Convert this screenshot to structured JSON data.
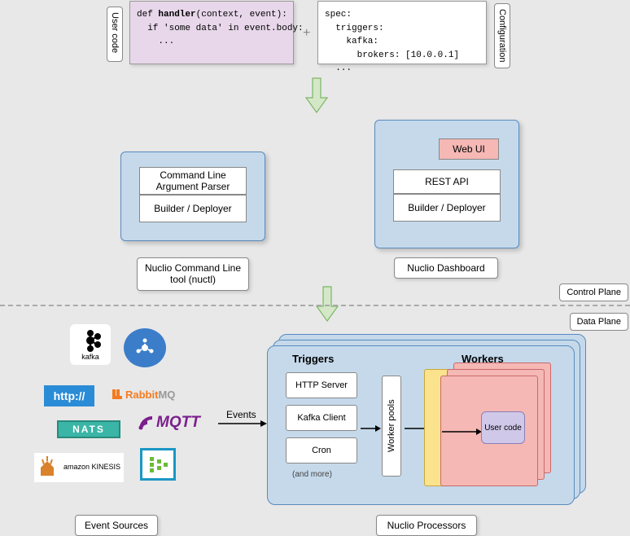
{
  "sidebar_labels": {
    "user_code": "User code",
    "configuration": "Configuration"
  },
  "code": {
    "user_code_snippet": "def handler(context, event):\n  if 'some data' in event.body:\n    ...",
    "config_snippet": "spec:\n  triggers:\n    kafka:\n      brokers: [10.0.0.1]\n  ..."
  },
  "plus": "+",
  "cli_panel": {
    "parser": "Command Line Argument Parser",
    "deployer": "Builder / Deployer",
    "label": "Nuclio Command Line tool (nuctl)"
  },
  "dashboard_panel": {
    "webui": "Web UI",
    "rest": "REST API",
    "deployer": "Builder / Deployer",
    "label": "Nuclio Dashboard"
  },
  "planes": {
    "control": "Control Plane",
    "data": "Data Plane"
  },
  "events_label": "Events",
  "sources": {
    "kafka": "kafka",
    "http": "http://",
    "rabbit_a": "Rabbit",
    "rabbit_b": "MQ",
    "nats": "NATS",
    "mqtt": "MQTT",
    "kinesis": "amazon KINESIS",
    "label": "Event Sources"
  },
  "processor": {
    "triggers_title": "Triggers",
    "workers_title": "Workers",
    "http": "HTTP Server",
    "kafka": "Kafka Client",
    "cron": "Cron",
    "more": "(and more)",
    "worker_pools": "Worker pools",
    "user_code": "User code",
    "label": "Nuclio Processors"
  }
}
